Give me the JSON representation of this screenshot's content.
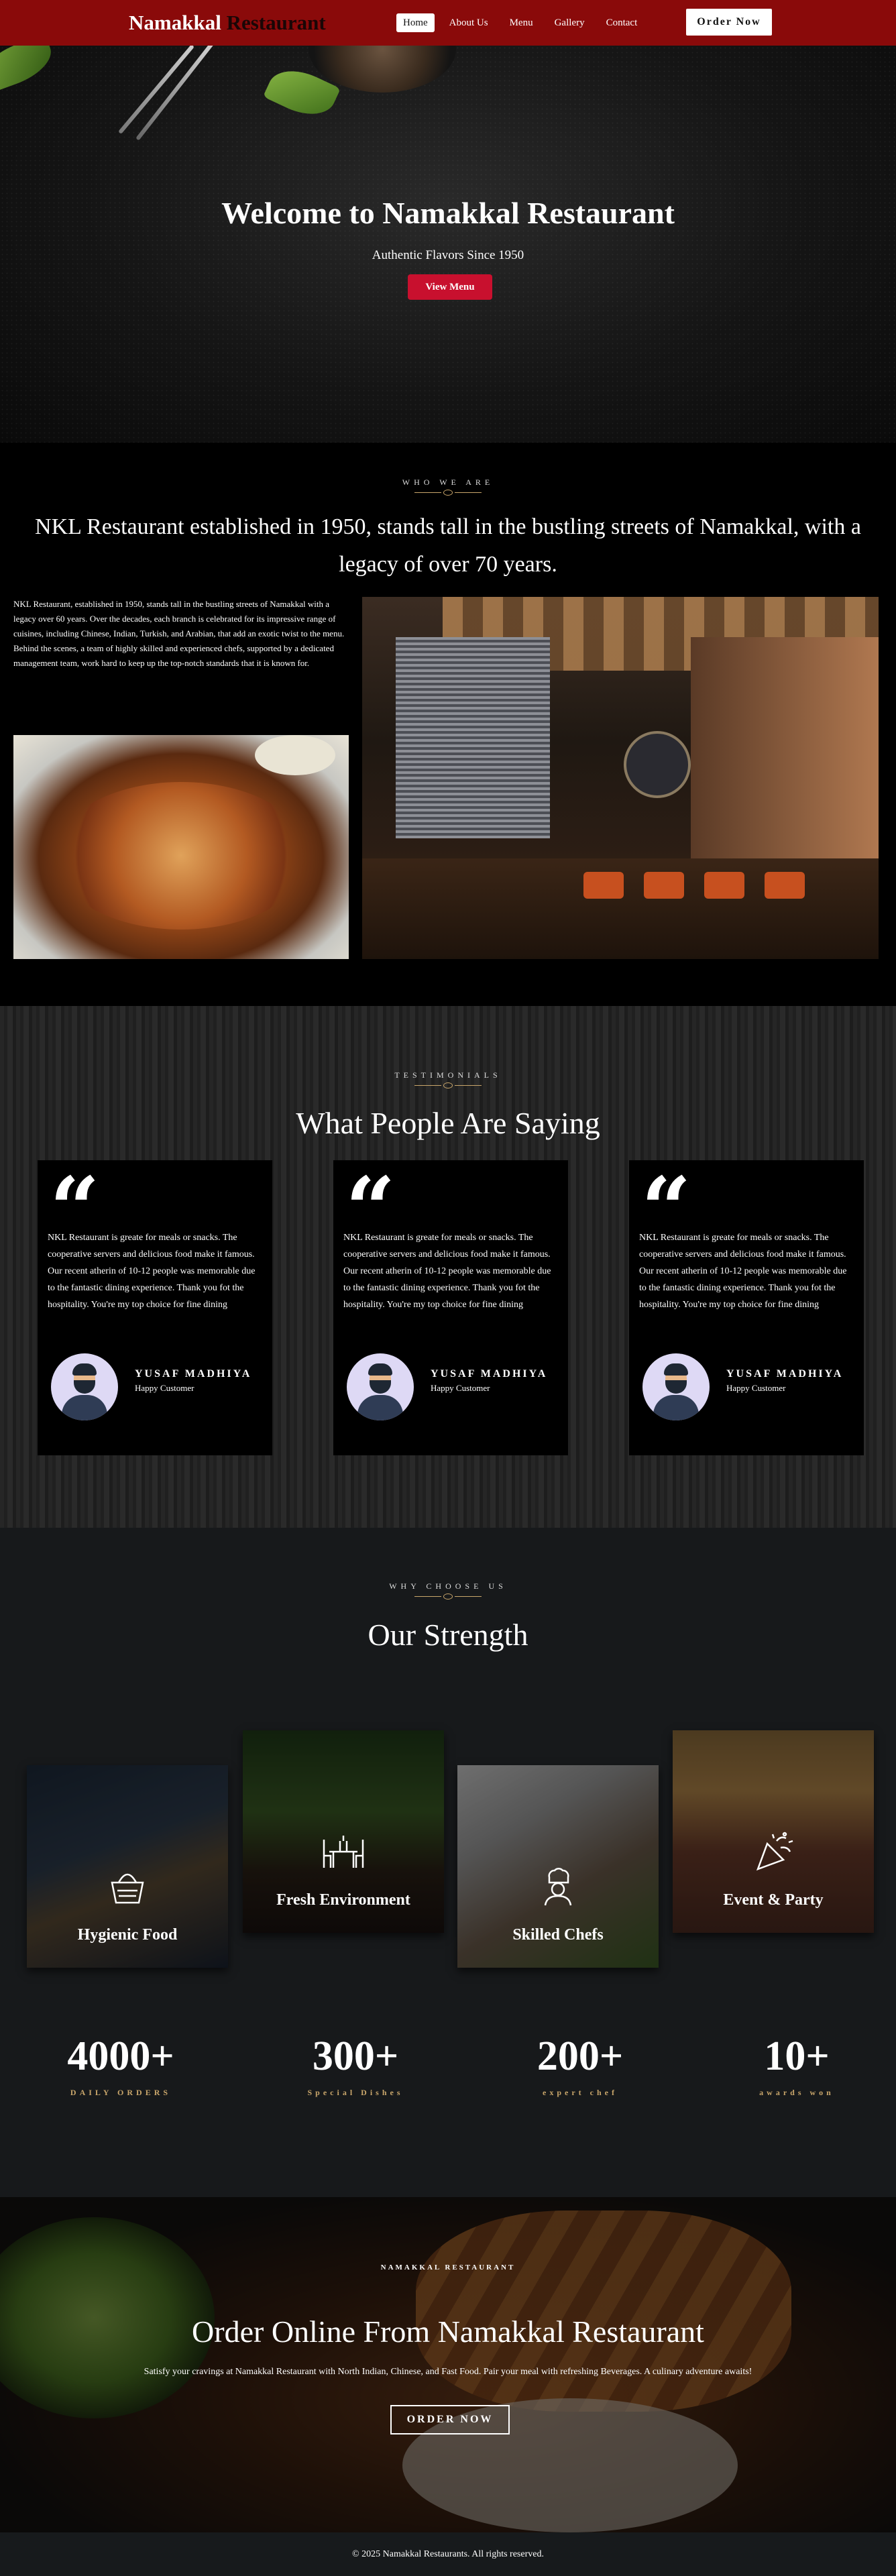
{
  "nav": {
    "brand_part1": "Namakkal",
    "brand_part2": " Restaurant",
    "links": [
      "Home",
      "About Us",
      "Menu",
      "Gallery",
      "Contact"
    ],
    "order_button": "Order Now"
  },
  "hero": {
    "title": "Welcome to Namakkal Restaurant",
    "subtitle": "Authentic Flavors Since 1950",
    "button": "View Menu"
  },
  "about": {
    "eyebrow": "WHO WE ARE",
    "title": "NKL Restaurant established in 1950, stands tall in the bustling streets of Namakkal, with a legacy of over 70 years.",
    "para1": "NKL Restaurant, established in 1950, stands tall in the bustling streets of Namakkal with a legacy over 60 years. Over the decades, each branch is celebrated for its impressive range of cuisines, including Chinese, Indian, Turkish, and Arabian, that add an exotic twist to the menu.",
    "para2": "Behind the scenes, a team of highly skilled and experienced chefs, supported by a dedicated management team, work hard to keep up the top-notch standards that it is known for."
  },
  "testimonials": {
    "eyebrow": "TESTIMONIALS",
    "title": "What People Are Saying",
    "cards": [
      {
        "text": "NKL Restaurant is greate for meals or snacks. The cooperative servers and delicious food make it famous. Our recent atherin of 10-12 people was memorable due to the fantastic dining experience. Thank you fot the hospitality. You're my top choice for fine dining",
        "name": "YUSAF MADHIYA",
        "role": "Happy Customer"
      },
      {
        "text": "NKL Restaurant is greate for meals or snacks. The cooperative servers and delicious food make it famous. Our recent atherin of 10-12 people was memorable due to the fantastic dining experience. Thank you fot the hospitality. You're my top choice for fine dining",
        "name": "YUSAF MADHIYA",
        "role": "Happy Customer"
      },
      {
        "text": "NKL Restaurant is greate for meals or snacks. The cooperative servers and delicious food make it famous. Our recent atherin of 10-12 people was memorable due to the fantastic dining experience. Thank you fot the hospitality. You're my top choice for fine dining",
        "name": "YUSAF MADHIYA",
        "role": "Happy Customer"
      }
    ]
  },
  "strength": {
    "eyebrow": "WHY CHOOSE US",
    "title": "Our Strength",
    "tiles": [
      "Hygienic Food",
      "Fresh Environment",
      "Skilled Chefs",
      "Event & Party"
    ],
    "stats": [
      {
        "num": "4000+",
        "label": "DAILY ORDERS"
      },
      {
        "num": "300+",
        "label": "Special Dishes"
      },
      {
        "num": "200+",
        "label": "expert chef"
      },
      {
        "num": "10+",
        "label": "awards won"
      }
    ]
  },
  "order": {
    "eyebrow": "NAMAKKAL RESTAURANT",
    "title": "Order Online From Namakkal Restaurant",
    "subtitle": "Satisfy your cravings at Namakkal Restaurant with North Indian, Chinese, and Fast Food. Pair your meal with refreshing Beverages. A culinary adventure awaits!",
    "button": "ORDER NOW"
  },
  "footer": {
    "copyright": "© 2025 Namakkal Restaurants. All rights reserved."
  },
  "colors": {
    "nav_bg": "#8a0a0a",
    "accent_red": "#c8102e",
    "gold": "#c9a66b"
  }
}
